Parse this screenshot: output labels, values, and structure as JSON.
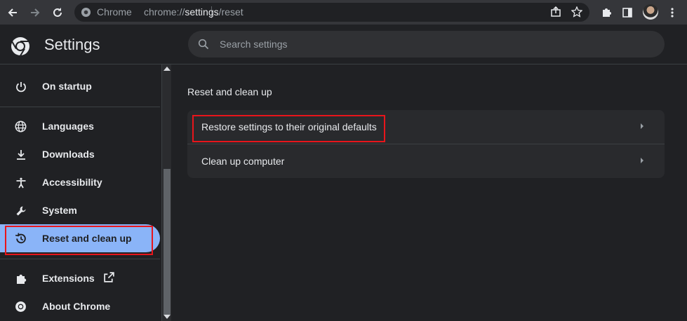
{
  "browser": {
    "site_label": "Chrome",
    "url_host": "chrome://",
    "url_path_bold": "settings",
    "url_rest": "/reset"
  },
  "header": {
    "title": "Settings",
    "search_placeholder": "Search settings"
  },
  "sidebar": {
    "items": [
      {
        "label": "On startup",
        "icon": "power-icon"
      },
      {
        "label": "Languages",
        "icon": "globe-icon"
      },
      {
        "label": "Downloads",
        "icon": "download-icon"
      },
      {
        "label": "Accessibility",
        "icon": "accessibility-icon"
      },
      {
        "label": "System",
        "icon": "wrench-icon"
      },
      {
        "label": "Reset and clean up",
        "icon": "restore-icon",
        "selected": true
      },
      {
        "label": "Extensions",
        "icon": "puzzle-icon"
      },
      {
        "label": "About Chrome",
        "icon": "chrome-icon"
      }
    ]
  },
  "main": {
    "section_title": "Reset and clean up",
    "rows": [
      {
        "label": "Restore settings to their original defaults"
      },
      {
        "label": "Clean up computer"
      }
    ]
  },
  "colors": {
    "accent": "#8ab4f8",
    "background": "#202124",
    "card": "#292a2d",
    "highlight": "#e8151b"
  }
}
